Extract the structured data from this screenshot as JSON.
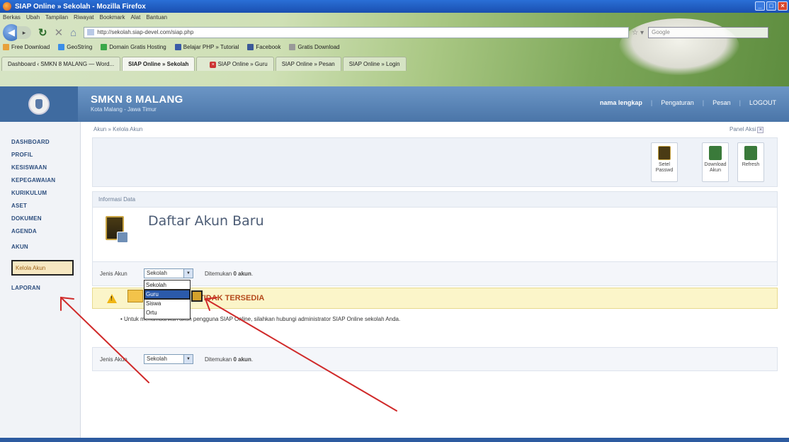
{
  "window": {
    "title": "SIAP Online » Sekolah - Mozilla Firefox"
  },
  "menubar": [
    "Berkas",
    "Ubah",
    "Tampilan",
    "Riwayat",
    "Bookmark",
    "Alat",
    "Bantuan"
  ],
  "nav": {
    "url": "http://sekolah.siap-devel.com/siap.php",
    "search_placeholder": "Google"
  },
  "bookmarks": [
    {
      "label": "Free Download",
      "color": "#e8a13a"
    },
    {
      "label": "GeoString",
      "color": "#3a8ee8"
    },
    {
      "label": "Domain Gratis Hosting",
      "color": "#3aa84a"
    },
    {
      "label": "Belajar PHP » Tutorial",
      "color": "#3a5ca8"
    },
    {
      "label": "Facebook",
      "color": "#3b5998"
    },
    {
      "label": "Gratis Download",
      "color": "#999999"
    }
  ],
  "tabs": [
    {
      "label": "Dashboard ‹ SMKN 8 MALANG — Word...",
      "active": false
    },
    {
      "label": "SIAP Online » Sekolah",
      "active": true
    },
    {
      "label": "SIAP Online » Guru",
      "active": false
    },
    {
      "label": "SIAP Online » Pesan",
      "active": false
    },
    {
      "label": "SIAP Online » Login",
      "active": false
    }
  ],
  "header": {
    "school_name": "SMKN 8 MALANG",
    "school_city": "Kota Malang - Jawa Timur",
    "user": "nama lengkap",
    "links": [
      "Pengaturan",
      "Pesan",
      "LOGOUT"
    ]
  },
  "sidebar": {
    "items": [
      "DASHBOARD",
      "PROFIL",
      "KESISWAAN",
      "KEPEGAWAIAN",
      "KURIKULUM",
      "ASET",
      "DOKUMEN",
      "AGENDA",
      "AKUN",
      "LAPORAN"
    ],
    "active_subitem": "Kelola Akun"
  },
  "breadcrumb": "Akun » Kelola Akun",
  "panel": {
    "label": "Panel Aksi"
  },
  "toolbar": {
    "buttons": [
      {
        "label": "Setel Passwd",
        "icon": "key-book-icon",
        "color": "#4a3b14"
      },
      {
        "label": "Download Akun",
        "icon": "download-icon",
        "color": "#3a7a3a"
      },
      {
        "label": "Refresh",
        "icon": "refresh-icon",
        "color": "#3a7a3a"
      }
    ]
  },
  "info": {
    "head": "Informasi Data",
    "title": "Daftar Akun Baru"
  },
  "filter": {
    "label": "Jenis Akun",
    "selected": "Sekolah",
    "options": [
      "Sekolah",
      "Guru",
      "Siswa",
      "Ortu"
    ],
    "highlighted_option": "Guru",
    "count_prefix": "Ditemukan",
    "count_value": "0 akun",
    "count_suffix": "."
  },
  "warning": {
    "text": "TIDAK TERSEDIA"
  },
  "note": "Untuk menambahkan akun pengguna SIAP Online, silahkan hubungi administrator SIAP Online sekolah Anda.",
  "annotation_color": "#d02a2a"
}
